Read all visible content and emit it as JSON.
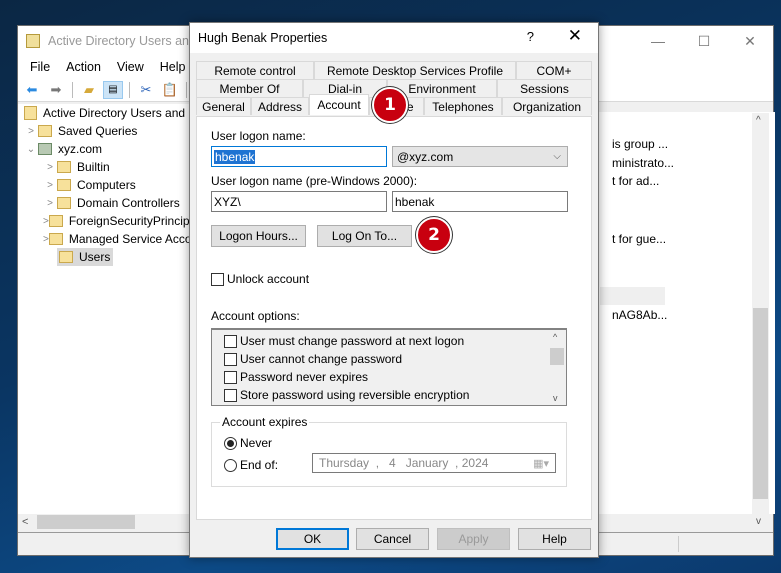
{
  "main_window": {
    "title": "Active Directory Users and Computers",
    "title_visible": "Active Directory Users and",
    "menu": [
      "File",
      "Action",
      "View",
      "Help"
    ],
    "toolbar_icons": [
      "back-arrow-icon",
      "forward-arrow-icon",
      "up-folder-icon",
      "show-console-tree-icon",
      "cut-icon",
      "paste-icon",
      "delete-icon"
    ],
    "tree": {
      "root": "Active Directory Users and Computers",
      "items": [
        {
          "label": "Saved Queries",
          "level": 1,
          "expander": "collapsed"
        },
        {
          "label": "xyz.com",
          "level": 1,
          "expander": "expanded"
        },
        {
          "label": "Builtin",
          "level": 2,
          "expander": "collapsed"
        },
        {
          "label": "Computers",
          "level": 2,
          "expander": "collapsed"
        },
        {
          "label": "Domain Controllers",
          "level": 2,
          "expander": "collapsed"
        },
        {
          "label": "ForeignSecurityPrincipals",
          "level": 2,
          "expander": "collapsed"
        },
        {
          "label": "Managed Service Accounts",
          "level": 2,
          "expander": "collapsed"
        },
        {
          "label": "Users",
          "level": 2,
          "expander": "none",
          "selected": true
        }
      ]
    },
    "right_pane_fragments": [
      "is group ...",
      "ministrato...",
      "t for ad...",
      "t for gue...",
      "nAG8Ab..."
    ]
  },
  "dialog": {
    "title": "Hugh Benak Properties",
    "help_btn": "?",
    "close_btn": "✕",
    "tabs_row1": [
      "Remote control",
      "Remote Desktop Services Profile",
      "COM+"
    ],
    "tabs_row2": [
      "Member Of",
      "Dial-in",
      "Environment",
      "Sessions"
    ],
    "tabs_row3": [
      "General",
      "Address",
      "Account",
      "Profile",
      "Telephones",
      "Organization"
    ],
    "active_tab": "Account",
    "user_logon_label": "User logon name:",
    "user_logon_value": "hbenak",
    "upn_suffix": "@xyz.com",
    "pre2000_label": "User logon name (pre-Windows 2000):",
    "pre2000_domain": "XYZ\\",
    "pre2000_user": "hbenak",
    "logon_hours_btn": "Logon Hours...",
    "logon_to_btn": "Log On To...",
    "unlock_label": "Unlock account",
    "unlock_checked": false,
    "account_options_label": "Account options:",
    "account_options": [
      {
        "label": "User must change password at next logon",
        "checked": false
      },
      {
        "label": "User cannot change password",
        "checked": false
      },
      {
        "label": "Password never expires",
        "checked": false
      },
      {
        "label": "Store password using reversible encryption",
        "checked": false
      }
    ],
    "account_expires_label": "Account expires",
    "never_label": "Never",
    "never_selected": true,
    "end_of_label": "End of:",
    "end_of_date": "Thursday  ,   4   January  , 2024",
    "buttons": {
      "ok": "OK",
      "cancel": "Cancel",
      "apply": "Apply",
      "help": "Help"
    }
  },
  "annotations": [
    {
      "number": "1",
      "target": "Account tab"
    },
    {
      "number": "2",
      "target": "Log On To button"
    }
  ]
}
